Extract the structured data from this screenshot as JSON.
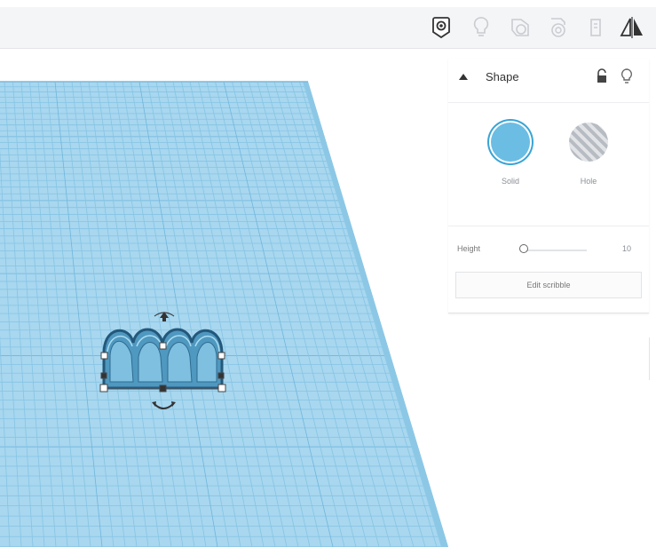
{
  "toolbar": {
    "icons": [
      "note-icon",
      "bulb-icon",
      "group-icon",
      "ungroup-icon",
      "align-icon",
      "mirror-icon"
    ]
  },
  "colors": {
    "workplane": "#a8d7ef",
    "grid_line": "#86c4e4",
    "shape_fill": "#5fa9cf",
    "shape_dark": "#24587a",
    "solid_swatch": "#6bbde3",
    "accent": "#3aa4d5"
  },
  "inspector": {
    "title": "Shape",
    "solid_label": "Solid",
    "hole_label": "Hole",
    "height_label": "Height",
    "height_value": "10",
    "edit_button_label": "Edit scribble"
  }
}
